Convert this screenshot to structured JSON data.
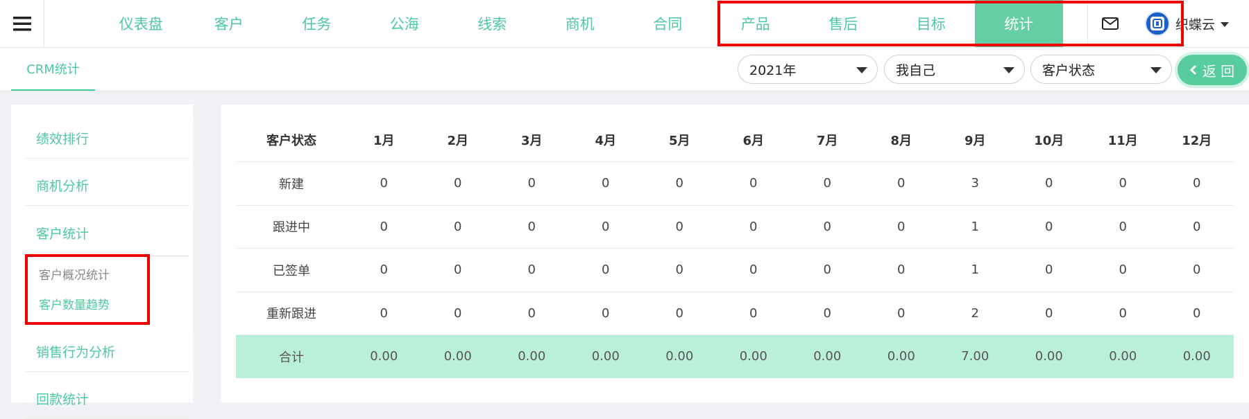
{
  "nav": {
    "items": [
      "仪表盘",
      "客户",
      "任务",
      "公海",
      "线索",
      "商机",
      "合同",
      "产品",
      "售后",
      "目标",
      "统计"
    ],
    "active_index": 10
  },
  "user": {
    "name": "织蝶云"
  },
  "subheader": {
    "tab": "CRM统计",
    "filters": {
      "year": "2021年",
      "scope": "我自己",
      "metric": "客户状态"
    },
    "back_label": "返 回"
  },
  "sidebar": {
    "items": [
      "绩效排行",
      "商机分析",
      "客户统计",
      "销售行为分析",
      "回款统计"
    ],
    "sub_items": [
      "客户概况统计",
      "客户数量趋势"
    ]
  },
  "table": {
    "header": [
      "客户状态",
      "1月",
      "2月",
      "3月",
      "4月",
      "5月",
      "6月",
      "7月",
      "8月",
      "9月",
      "10月",
      "11月",
      "12月"
    ],
    "rows": [
      {
        "label": "新建",
        "values": [
          "0",
          "0",
          "0",
          "0",
          "0",
          "0",
          "0",
          "0",
          "3",
          "0",
          "0",
          "0"
        ]
      },
      {
        "label": "跟进中",
        "values": [
          "0",
          "0",
          "0",
          "0",
          "0",
          "0",
          "0",
          "0",
          "1",
          "0",
          "0",
          "0"
        ]
      },
      {
        "label": "已签单",
        "values": [
          "0",
          "0",
          "0",
          "0",
          "0",
          "0",
          "0",
          "0",
          "1",
          "0",
          "0",
          "0"
        ]
      },
      {
        "label": "重新跟进",
        "values": [
          "0",
          "0",
          "0",
          "0",
          "0",
          "0",
          "0",
          "0",
          "2",
          "0",
          "0",
          "0"
        ]
      }
    ],
    "total": {
      "label": "合计",
      "values": [
        "0.00",
        "0.00",
        "0.00",
        "0.00",
        "0.00",
        "0.00",
        "0.00",
        "0.00",
        "7.00",
        "0.00",
        "0.00",
        "0.00"
      ]
    }
  },
  "colors": {
    "accent": "#4ec99a",
    "active_tab_bg": "#65cfa4",
    "total_row_bg": "#baf0da",
    "highlight": "#ee0000"
  }
}
